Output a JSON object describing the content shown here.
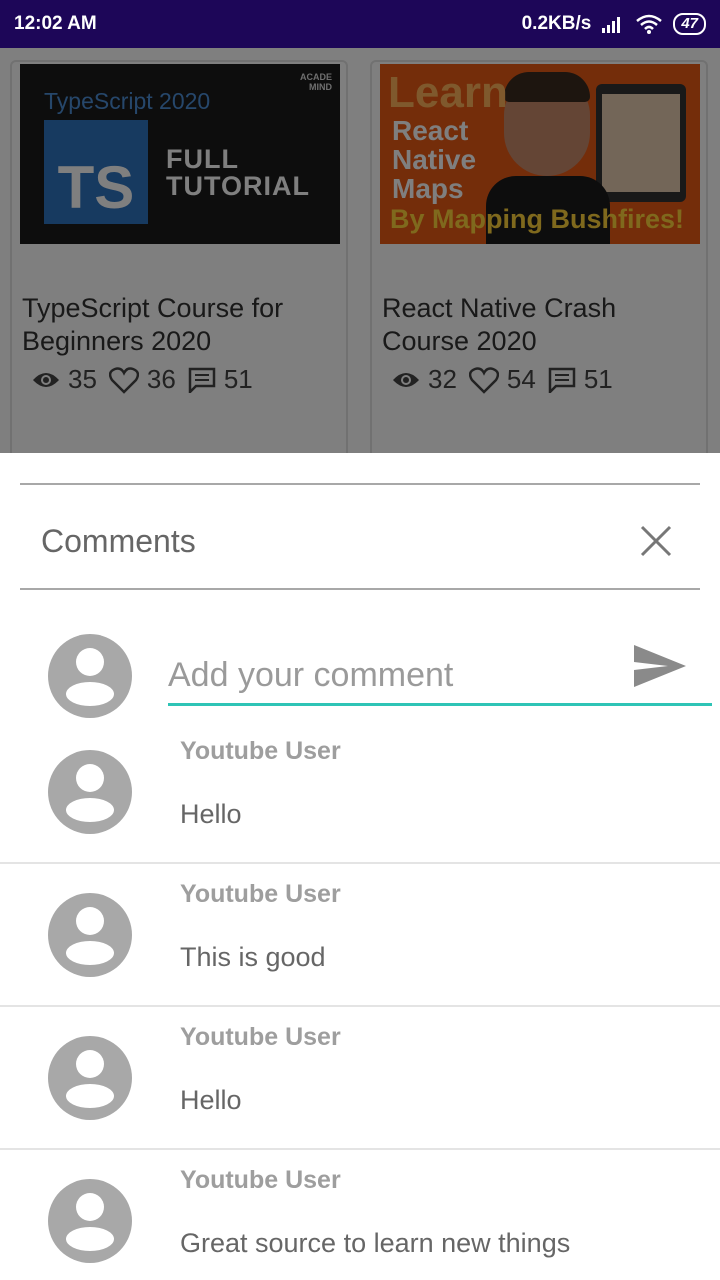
{
  "status_bar": {
    "time": "12:02 AM",
    "network_speed": "0.2KB/s",
    "battery": "47",
    "signal_icon": "signal-icon",
    "wifi_icon": "wifi-icon"
  },
  "videos": [
    {
      "title": "TypeScript Course for Beginners 2020",
      "thumbnail": {
        "heading": "TypeScript 2020",
        "badge": "TS",
        "caption_line1": "FULL",
        "caption_line2": "TUTORIAL",
        "brand_line1": "ACADE",
        "brand_line2": "MIND"
      },
      "views": "35",
      "likes": "36",
      "comments": "51"
    },
    {
      "title": "React Native Crash Course 2020",
      "thumbnail": {
        "heading": "Learn",
        "line1": "React",
        "line2": "Native",
        "line3": "Maps",
        "bottom": "By Mapping Bushfires!"
      },
      "views": "32",
      "likes": "54",
      "comments": "51"
    }
  ],
  "comments_sheet": {
    "title": "Comments",
    "input_placeholder": "Add your comment",
    "accent_color": "#2ec4b6",
    "comments": [
      {
        "author": "Youtube User",
        "text": "Hello"
      },
      {
        "author": "Youtube User",
        "text": "This is good"
      },
      {
        "author": "Youtube User",
        "text": "Hello"
      },
      {
        "author": "Youtube User",
        "text": "Great source to learn new things"
      }
    ]
  }
}
